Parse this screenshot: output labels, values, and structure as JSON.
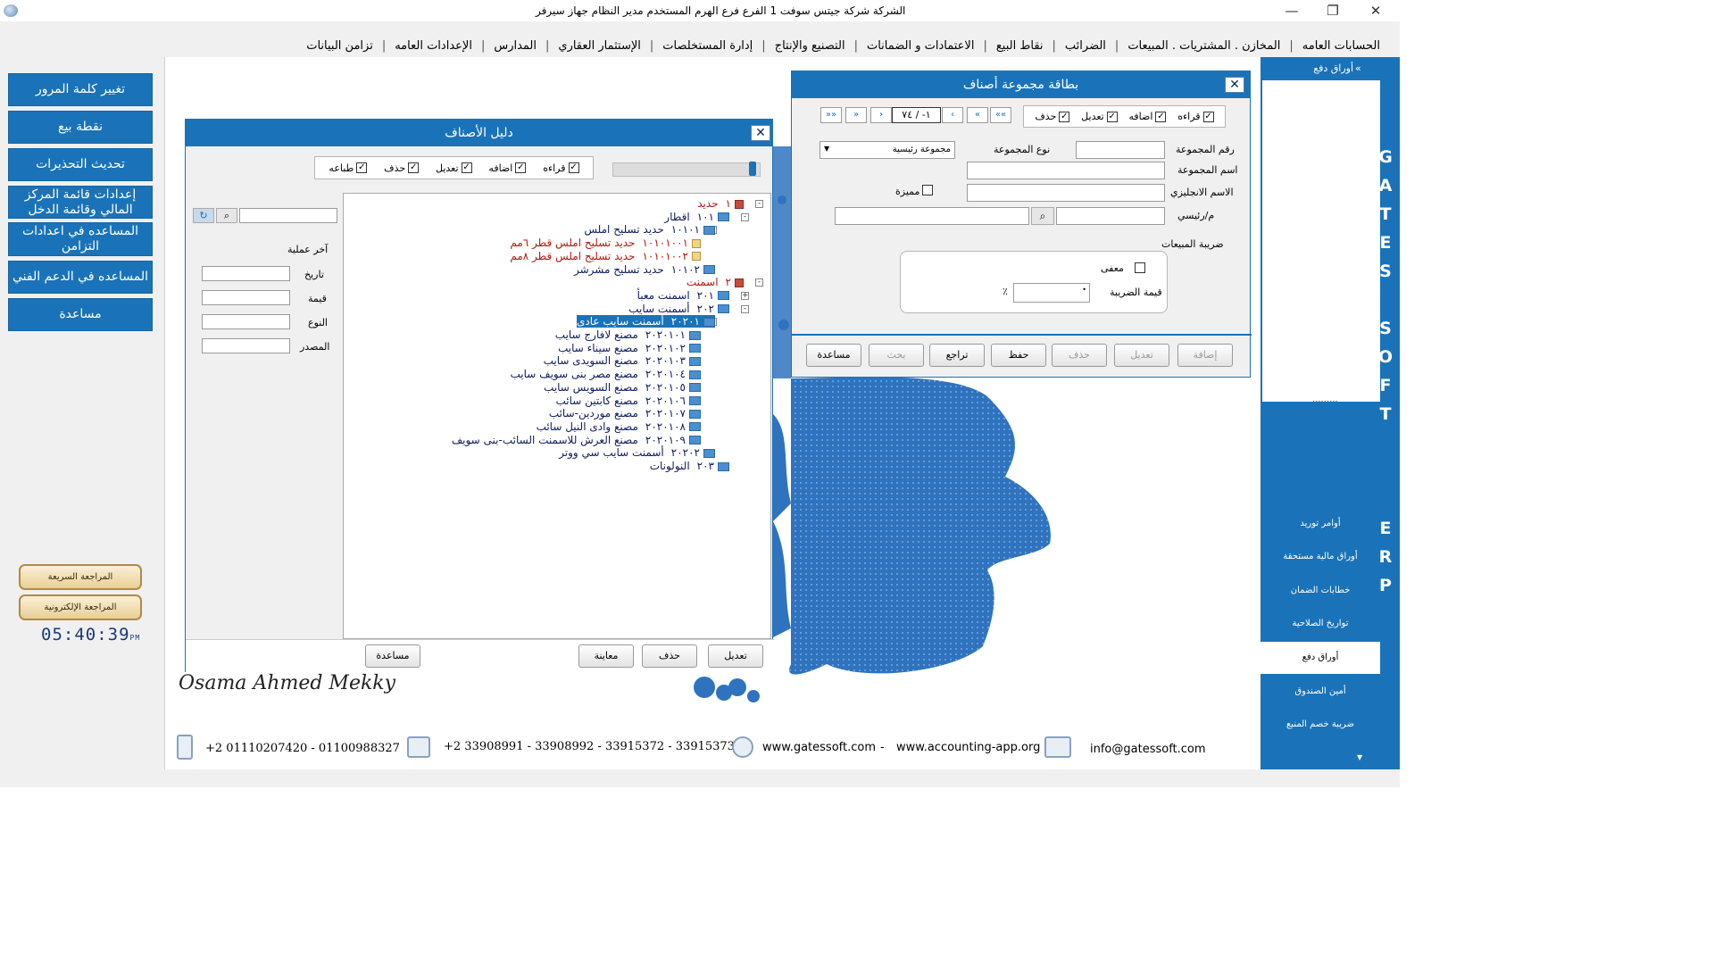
{
  "title_bar": {
    "title": "الشركة شركة جيتس سوفت 1   الفرع فرع الهرم   المستخدم مدير النظام  جهاز سيرفر"
  },
  "menu": [
    "الحسابات العامه",
    "المخازن . المشتريات . المبيعات",
    "الضرائب",
    "نقاط البيع",
    "الاعتمادات و الضمانات",
    "التصنيع والإنتاج",
    "إدارة المستخلصات",
    "الإستثمار العقاري",
    "المدارس",
    "الإعدادات العامه",
    "تزامن البيانات"
  ],
  "left_buttons": [
    "تغيير كلمة المرور",
    "نقطة بيع",
    "تحديث التحذيرات",
    "إعدادات قائمة المركز المالي وقائمة الدخل",
    "المساعده في اعدادات التزامن",
    "المساعده في الدعم الفني",
    "مساعدة"
  ],
  "quick_review": "المراجعة السريعة",
  "electronic_review": "المراجعة الإلكترونية",
  "clock": {
    "time": "05:40:39",
    "ampm": "PM"
  },
  "right_nav": {
    "top_item": "أوراق دفع",
    "gates_letters": [
      "G",
      "A",
      "T",
      "E",
      "S",
      "",
      "S",
      "O",
      "F",
      "T",
      "",
      "",
      "",
      "E",
      "R",
      "P"
    ],
    "items": [
      "أوامر توريد",
      "أوراق مالية مستحقة",
      "خطابات الضمان",
      "تواريخ الصلاحية",
      "أوراق دفع",
      "أمين الصندوق",
      "ضريبة خصم المنبع"
    ],
    "active_item": "أوراق دفع"
  },
  "signature": "Osama Ahmed Mekky",
  "footer": {
    "mobile": "+2 01110207420 - 01100988327",
    "phone": "+2 33908991 - 33908992 - 33915372 - 33915373",
    "website": "www.gatessoft.com",
    "dash": "-",
    "website2": "www.accounting-app.org",
    "email": "info@gatessoft.com"
  },
  "directory_window": {
    "title": "دليل الأصناف",
    "permissions": [
      "قراءه",
      "اضافه",
      "تعديل",
      "حذف",
      "طباعه"
    ],
    "last_op_title": "آخر عملية",
    "fields": [
      "تاريخ",
      "قيمة",
      "النوع",
      "المصدر"
    ],
    "buttons": {
      "edit": "تعديل",
      "delete": "حذف",
      "preview": "معاينة",
      "help": "مساعدة"
    },
    "tree": [
      {
        "code": "١",
        "name": "حديد",
        "level": 0,
        "color": "red",
        "type": "root",
        "exp": "-"
      },
      {
        "code": "١٠١",
        "name": "اقطار",
        "level": 1,
        "color": "navy",
        "type": "folder",
        "exp": "-"
      },
      {
        "code": "١٠١٠١",
        "name": "حديد تسليح املس",
        "level": 2,
        "color": "navy",
        "type": "folder",
        "exp": "-"
      },
      {
        "code": "١٠١٠١٠٠١",
        "name": "حديد تسليح املس قطر ٦مم",
        "level": 3,
        "color": "red",
        "type": "file",
        "exp": ""
      },
      {
        "code": "١٠١٠١٠٠٢",
        "name": "حديد تسليح املس قطر ٨مم",
        "level": 3,
        "color": "red",
        "type": "file",
        "exp": ""
      },
      {
        "code": "١٠١٠٢",
        "name": "حديد تسليح مشرشر",
        "level": 2,
        "color": "navy",
        "type": "folder",
        "exp": ""
      },
      {
        "code": "٢",
        "name": "اسمنت",
        "level": 0,
        "color": "red",
        "type": "root",
        "exp": "-"
      },
      {
        "code": "٢٠١",
        "name": "اسمنت معبأ",
        "level": 1,
        "color": "navy",
        "type": "folder",
        "exp": "+"
      },
      {
        "code": "٢٠٢",
        "name": "أسمنت سايب",
        "level": 1,
        "color": "navy",
        "type": "folder",
        "exp": "-"
      },
      {
        "code": "٢٠٢٠١",
        "name": "أسمنت سايب عادى",
        "level": 2,
        "color": "sel",
        "type": "folder",
        "exp": "-"
      },
      {
        "code": "٢٠٢٠١٠١",
        "name": "مصنع لافارج سايب",
        "level": 3,
        "color": "navy",
        "type": "folder",
        "exp": ""
      },
      {
        "code": "٢٠٢٠١٠٢",
        "name": "مصنع سيناء سايب",
        "level": 3,
        "color": "navy",
        "type": "folder",
        "exp": ""
      },
      {
        "code": "٢٠٢٠١٠٣",
        "name": "مصنع السويدى سايب",
        "level": 3,
        "color": "navy",
        "type": "folder",
        "exp": ""
      },
      {
        "code": "٢٠٢٠١٠٤",
        "name": "مصنع مصر  بنى سويف سايب",
        "level": 3,
        "color": "navy",
        "type": "folder",
        "exp": ""
      },
      {
        "code": "٢٠٢٠١٠٥",
        "name": "مصنع السويس سايب",
        "level": 3,
        "color": "navy",
        "type": "folder",
        "exp": ""
      },
      {
        "code": "٢٠٢٠١٠٦",
        "name": "مصنع كابتين سائب",
        "level": 3,
        "color": "navy",
        "type": "folder",
        "exp": ""
      },
      {
        "code": "٢٠٢٠١٠٧",
        "name": "مصنع موردين-سائب",
        "level": 3,
        "color": "navy",
        "type": "folder",
        "exp": ""
      },
      {
        "code": "٢٠٢٠١٠٨",
        "name": "مصنع وادى النيل سائب",
        "level": 3,
        "color": "navy",
        "type": "folder",
        "exp": ""
      },
      {
        "code": "٢٠٢٠١٠٩",
        "name": "مصنع العرش للاسمنت السائب-بنى سويف",
        "level": 3,
        "color": "navy",
        "type": "folder",
        "exp": ""
      },
      {
        "code": "٢٠٢٠٢",
        "name": "أسمنت سايب سي ووتر",
        "level": 2,
        "color": "navy",
        "type": "folder",
        "exp": ""
      },
      {
        "code": "٢٠٣",
        "name": "النولونات",
        "level": 1,
        "color": "navy",
        "type": "folder",
        "exp": ""
      }
    ]
  },
  "group_card": {
    "title": "بطاقة مجموعة أصناف",
    "permissions": [
      "قراءه",
      "اضافه",
      "تعديل",
      "حذف"
    ],
    "record_counter": "١- / ٧٤",
    "nav_buttons": [
      "»»",
      "»",
      "›",
      "‹",
      "«",
      "««"
    ],
    "labels": {
      "group_no": "رقم المجموعة",
      "group_type": "نوع المجموعة",
      "group_name": "اسم المجموعة",
      "english_name": "الاسم الانجليزي",
      "parent": "م/رئيسي",
      "featured": "مميزة",
      "sales_tax": "ضريبة المبيعات",
      "exempt": "معفى",
      "tax_value": "قيمة الضريبة",
      "percent": "٪"
    },
    "group_type_value": "مجموعة رئيسية",
    "buttons": [
      "إضافة",
      "تعديل",
      "حذف",
      "حفظ",
      "تراجع",
      "بحث",
      "مساعدة"
    ],
    "disabled_buttons": [
      "إضافة",
      "تعديل",
      "حذف",
      "بحث"
    ]
  },
  "colors": {
    "accent": "#1a73b8",
    "light": "#f0f0f0",
    "tree_red": "#b3160f",
    "tree_navy": "#0e1c5c"
  }
}
